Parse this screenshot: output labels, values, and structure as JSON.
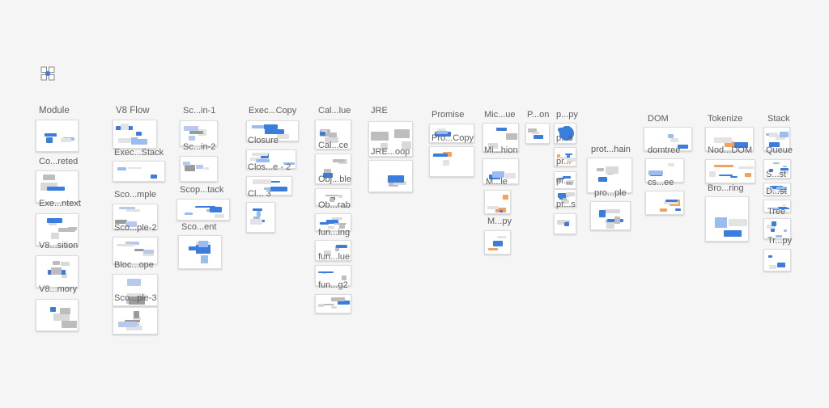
{
  "canvas": {
    "accent_color": "#3b7ddd",
    "frames": [
      {
        "label": "Module"
      },
      {
        "label": "Co...reted"
      },
      {
        "label": "Exe...ntext"
      },
      {
        "label": "V8...sition"
      },
      {
        "label": "V8...mory"
      },
      {
        "label": "V8 Flow"
      },
      {
        "label": "Exec...Stack"
      },
      {
        "label": "Sco...mple"
      },
      {
        "label": "Sco...ple-2"
      },
      {
        "label": "Bloc...ope"
      },
      {
        "label": "Sco...ple-3"
      },
      {
        "label": "Sc...in-1"
      },
      {
        "label": "Sc...in-2"
      },
      {
        "label": "Scop...tack"
      },
      {
        "label": "Sco...ent"
      },
      {
        "label": "Exec...Copy"
      },
      {
        "label": "Closure"
      },
      {
        "label": "Clos...e - 2"
      },
      {
        "label": "Cl... 3"
      },
      {
        "label": "Cal...lue"
      },
      {
        "label": "Cal...ce"
      },
      {
        "label": "Obj...ble"
      },
      {
        "label": "Ob...rab"
      },
      {
        "label": "fun...ing"
      },
      {
        "label": "fun...lue"
      },
      {
        "label": "fun...g2"
      },
      {
        "label": "JRE"
      },
      {
        "label": "JRE...oop"
      },
      {
        "label": "Promise"
      },
      {
        "label": "Pro...Copy"
      },
      {
        "label": "Mic...ue"
      },
      {
        "label": "Mi...hion"
      },
      {
        "label": "M...le"
      },
      {
        "label": "M...py"
      },
      {
        "label": "P...on"
      },
      {
        "label": "p...py"
      },
      {
        "label": "p...s"
      },
      {
        "label": "pr..."
      },
      {
        "label": "pr..."
      },
      {
        "label": "pr...s"
      },
      {
        "label": "prot...hain"
      },
      {
        "label": "pro...ple"
      },
      {
        "label": "DOM"
      },
      {
        "label": "domtree"
      },
      {
        "label": "cs...ee"
      },
      {
        "label": "Tokenize"
      },
      {
        "label": "Nod...DOM"
      },
      {
        "label": "Bro...ring"
      },
      {
        "label": "Stack"
      },
      {
        "label": "Queue"
      },
      {
        "label": "S...st"
      },
      {
        "label": "D...st"
      },
      {
        "label": "Tree"
      },
      {
        "label": "Tr...py"
      }
    ]
  }
}
